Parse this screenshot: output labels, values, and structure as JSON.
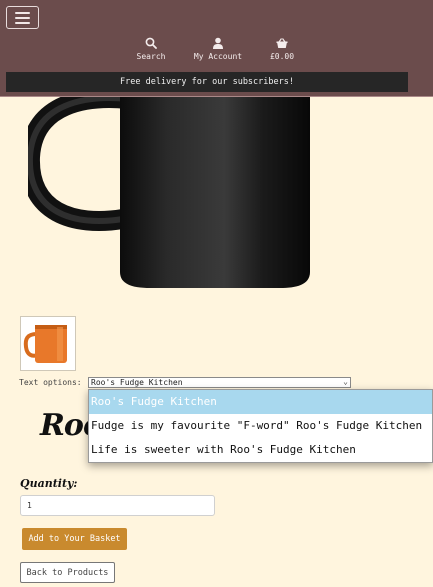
{
  "header": {
    "background": "#6b4c4c",
    "nav": {
      "search_label": "Search",
      "account_label": "My Account",
      "basket_total": "£0.00"
    },
    "banner_text": "Free delivery for our subscribers!"
  },
  "product": {
    "main_image_icon": "black-mug-image",
    "thumbnail_icon": "orange-mug-image"
  },
  "options": {
    "label": "Text options:",
    "selected": "Roo's Fudge Kitchen",
    "items": [
      "Roo's Fudge Kitchen",
      "Fudge is my favourite \"F-word\" Roo's Fudge Kitchen",
      "Life is sweeter with Roo's Fudge Kitchen"
    ]
  },
  "preview": {
    "visible_text": "Roo"
  },
  "quantity": {
    "label": "Quantity:",
    "value": "1"
  },
  "buttons": {
    "add_to_basket": "Add to Your Basket",
    "back_to_products": "Back to Products"
  },
  "colors": {
    "page_bg": "#fff5de",
    "accent": "#c98a2e",
    "dropdown_highlight": "#a8d8ee"
  }
}
